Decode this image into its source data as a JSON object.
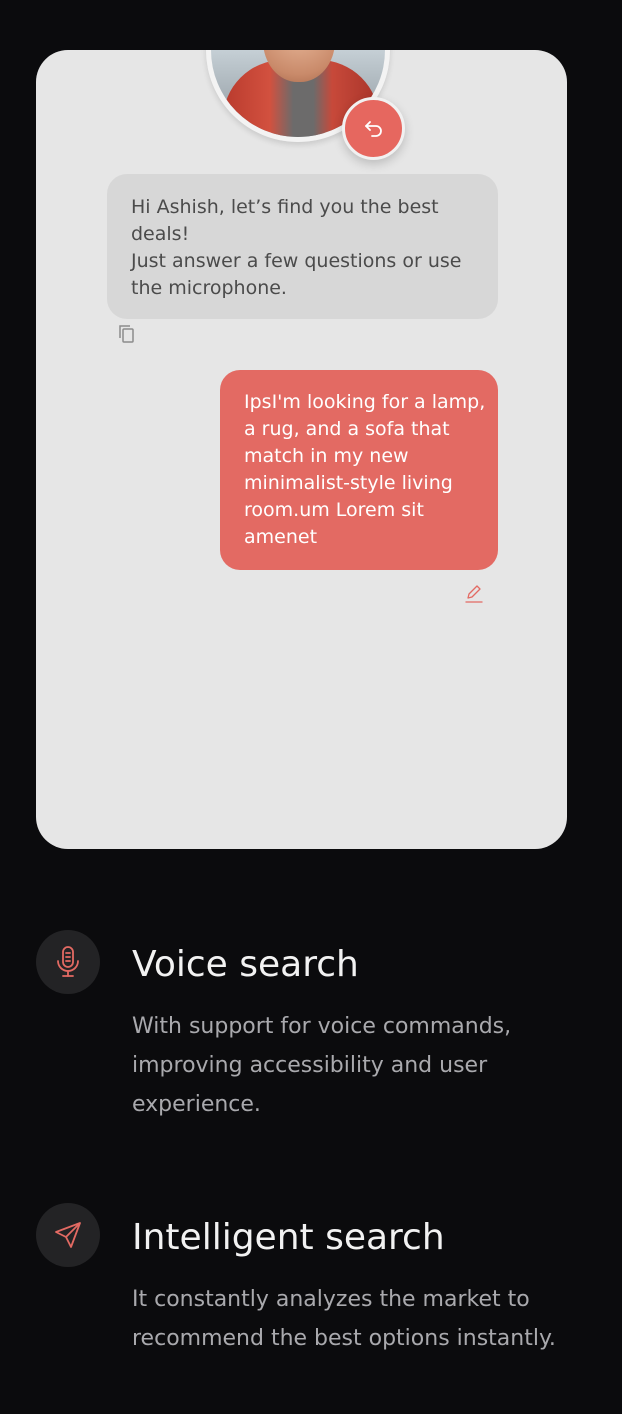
{
  "chat": {
    "bot_message_lines": [
      "Hi Ashish, let’s find you the best deals!",
      "Just answer a few questions or use the microphone."
    ],
    "user_message": "IpsI'm looking for a lamp, a rug, and a sofa that match in my new minimalist-style living room.um Lorem sit amenet"
  },
  "features": [
    {
      "icon": "microphone-icon",
      "title": "Voice search",
      "description": "With support for voice commands, improving accessibility and user experience."
    },
    {
      "icon": "navigation-arrow-icon",
      "title": "Intelligent search",
      "description": "It constantly analyzes the market to recommend the best options instantly."
    }
  ],
  "colors": {
    "background": "#0b0b0d",
    "card": "#e6e6e6",
    "accent": "#e36a63",
    "bot_bubble": "#d7d7d7",
    "icon_circle": "#232325"
  }
}
